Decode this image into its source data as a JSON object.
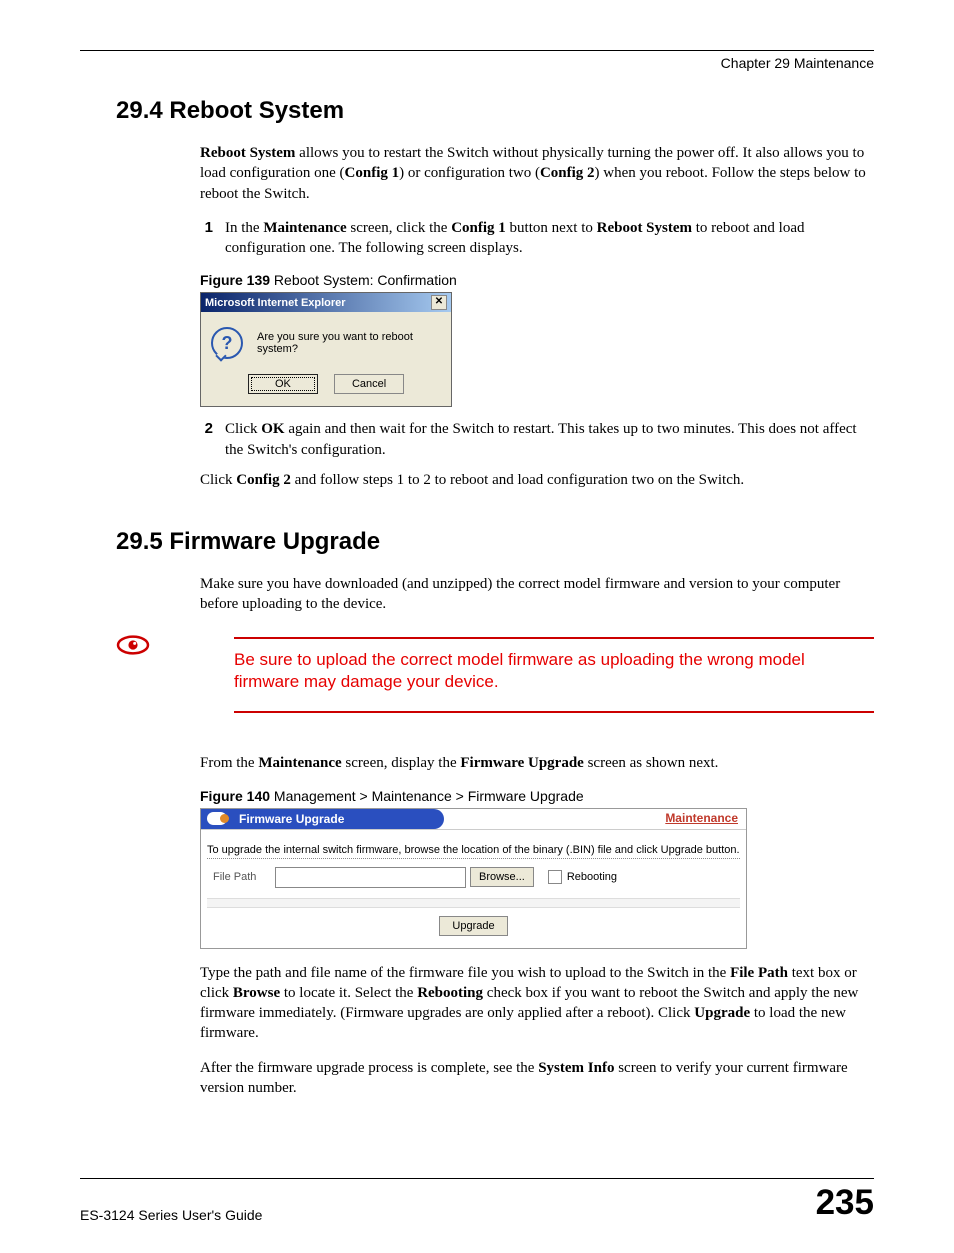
{
  "header": {
    "chapter": "Chapter 29 Maintenance"
  },
  "s294": {
    "heading": "29.4  Reboot System",
    "p1_a": "Reboot System",
    "p1_b": " allows you to restart the Switch without physically turning the power off. It also allows you to load configuration one (",
    "p1_c": "Config 1",
    "p1_d": ") or configuration two (",
    "p1_e": "Config 2",
    "p1_f": ") when you reboot. Follow the steps below to reboot the Switch.",
    "step1_num": "1",
    "step1_a": "In the ",
    "step1_b": "Maintenance",
    "step1_c": " screen, click the ",
    "step1_d": "Config 1",
    "step1_e": " button next to ",
    "step1_f": "Reboot System",
    "step1_g": " to reboot and load configuration one. The following screen displays.",
    "fig139_label": "Figure 139",
    "fig139_caption": "   Reboot System: Confirmation",
    "dialog": {
      "title": "Microsoft Internet Explorer",
      "msg": "Are you sure you want to reboot system?",
      "ok": "OK",
      "cancel": "Cancel",
      "close": "✕"
    },
    "step2_num": "2",
    "step2_a": "Click ",
    "step2_b": "OK",
    "step2_c": " again and then wait for the Switch to restart. This takes up to two minutes. This does not affect the Switch's configuration.",
    "p2_a": "Click ",
    "p2_b": "Config 2",
    "p2_c": " and follow steps 1 to 2 to reboot and load configuration two on the Switch."
  },
  "s295": {
    "heading": "29.5  Firmware Upgrade",
    "p1": "Make sure you have downloaded (and unzipped) the correct model firmware and version to your computer before uploading to the device.",
    "warning": "Be sure to upload the correct model firmware as uploading the wrong model firmware may damage your device.",
    "p2_a": "From the ",
    "p2_b": "Maintenance",
    "p2_c": " screen, display the ",
    "p2_d": "Firmware Upgrade",
    "p2_e": " screen as shown next.",
    "fig140_label": "Figure 140",
    "fig140_caption": "   Management > Maintenance > Firmware Upgrade",
    "panel": {
      "tab": "Firmware Upgrade",
      "link": "Maintenance",
      "instr": "To upgrade the internal switch firmware, browse the location of the binary (.BIN) file and click Upgrade button.",
      "filepath_label": "File Path",
      "browse": "Browse...",
      "rebooting": "Rebooting",
      "upgrade": "Upgrade"
    },
    "p3_a": "Type the path and file name of the firmware file you wish to upload to the Switch in the ",
    "p3_b": "File Path",
    "p3_c": " text box or click ",
    "p3_d": "Browse",
    "p3_e": " to locate it. Select the ",
    "p3_f": "Rebooting",
    "p3_g": " check box if you want to reboot the Switch and apply the new firmware immediately. (Firmware upgrades are only applied after a reboot). Click ",
    "p3_h": "Upgrade",
    "p3_i": " to load the new firmware.",
    "p4_a": "After the firmware upgrade process is complete, see the ",
    "p4_b": "System Info",
    "p4_c": " screen to verify your current firmware version number."
  },
  "footer": {
    "guide": "ES-3124 Series User's Guide",
    "page": "235"
  }
}
